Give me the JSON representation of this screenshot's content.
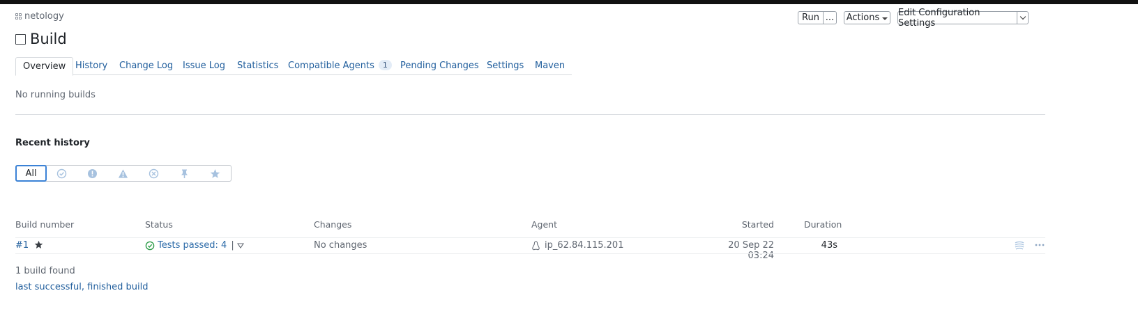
{
  "breadcrumb": {
    "project": "netology"
  },
  "page": {
    "title": "Build"
  },
  "toolbar": {
    "run_label": "Run",
    "run_more_label": "...",
    "actions_label": "Actions",
    "edit_label": "Edit Configuration Settings"
  },
  "tabs": [
    {
      "label": "Overview"
    },
    {
      "label": "History"
    },
    {
      "label": "Change Log"
    },
    {
      "label": "Issue Log"
    },
    {
      "label": "Statistics"
    },
    {
      "label": "Compatible Agents",
      "count": "1"
    },
    {
      "label": "Pending Changes"
    },
    {
      "label": "Settings"
    },
    {
      "label": "Maven"
    }
  ],
  "running": {
    "text": "No running builds"
  },
  "history": {
    "title": "Recent history",
    "filter_all": "All",
    "filter_icons": [
      "success-filter-icon",
      "failed-filter-icon",
      "warning-filter-icon",
      "cancelled-filter-icon",
      "pinned-filter-icon",
      "starred-filter-icon"
    ]
  },
  "table": {
    "columns": {
      "build_number": "Build number",
      "status": "Status",
      "changes": "Changes",
      "agent": "Agent",
      "started": "Started",
      "duration": "Duration"
    },
    "rows": [
      {
        "number": "#1",
        "status": "Tests passed: 4",
        "status_sep": "|",
        "changes": "No changes",
        "agent": "ip_62.84.115.201",
        "started": "20 Sep 22 03:24",
        "duration": "43s"
      }
    ]
  },
  "footer": {
    "count_text": "1 build found",
    "link_text": "last successful, finished build"
  },
  "colors": {
    "link": "#1f5d9c",
    "success": "#2e9d4a",
    "accent_border": "#3b82d6",
    "filter_icon": "#a7c2df"
  }
}
